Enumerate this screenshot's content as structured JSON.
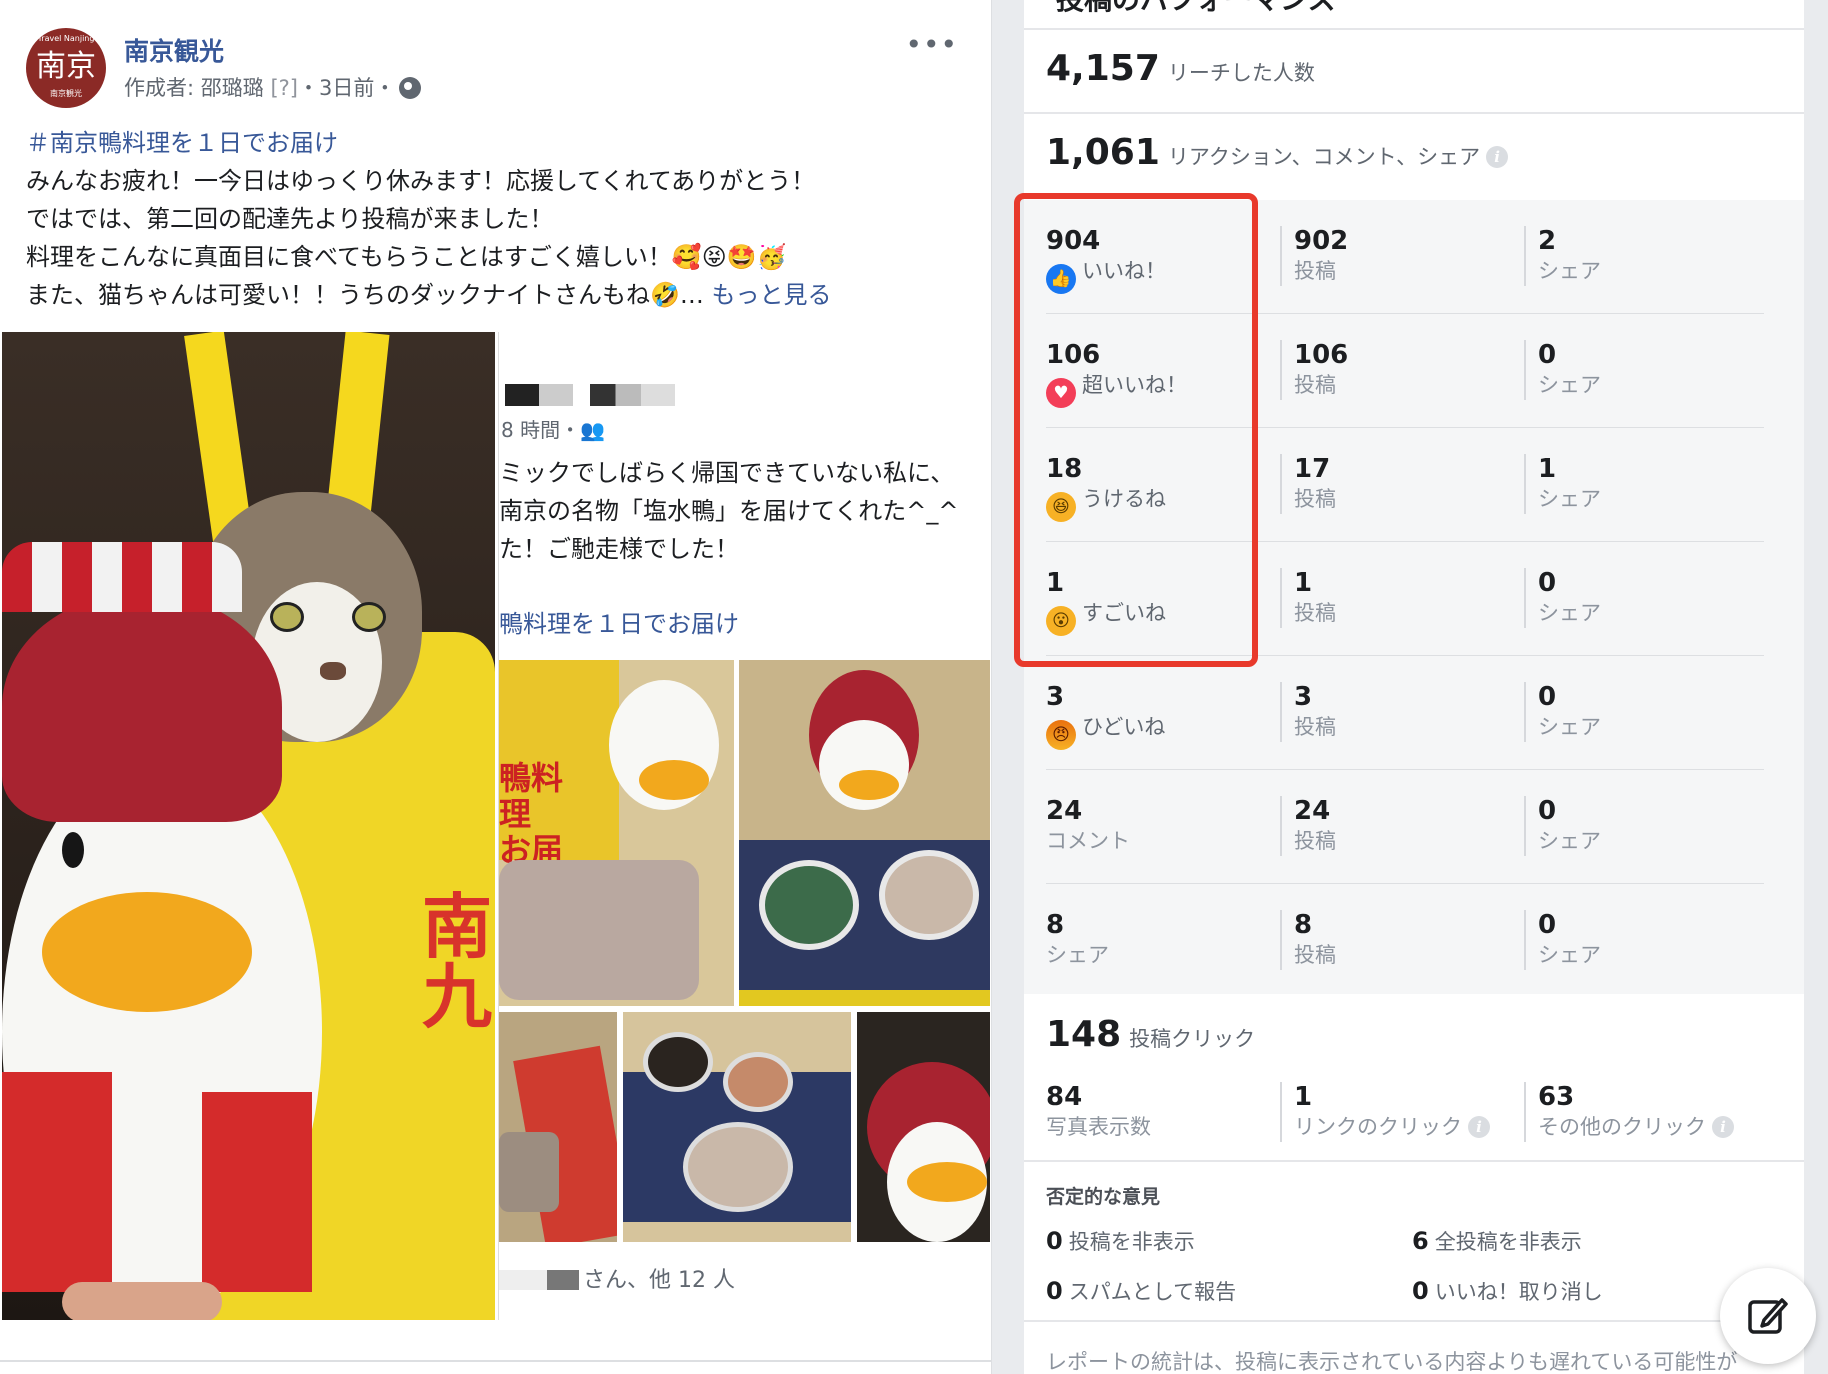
{
  "post": {
    "avatar": {
      "top": "Travel Nanjing",
      "main": "南京",
      "sub": "南京観光"
    },
    "page_name": "南京観光",
    "meta_author": "作成者: 邵璐璐",
    "meta_q": "[?]",
    "meta_time": "・3日前・",
    "more_icon": "•••",
    "hashtag": "＃南京鴨料理を１日でお届け",
    "lines": [
      "みんなお疲れ！一今日はゆっくり休みます！応援してくれてありがとう！",
      "ではでは、第二回の配達先より投稿が来ました！",
      "料理をこんなに真面目に食べてもらうことはすごく嬉しい！🥰😝🤩🥳",
      "また、猫ちゃんは可愛い！！うちのダックナイトさんもね🤣…"
    ],
    "see_more": "もっと見る",
    "shared": {
      "time": "8 時間・👥",
      "text_lines": [
        "ミックでしばらく帰国できていない私に、",
        "南京の名物「塩水鴨」を届けてくれた^_^",
        "た！ご馳走様でした！"
      ],
      "hashtag": "鴨料理を１日でお届け",
      "likes": "さん、他 12 人"
    }
  },
  "insights": {
    "title": "投稿のパフォーマンス",
    "reach": {
      "value": "4,157",
      "label": "リーチした人数"
    },
    "engagement": {
      "value": "1,061",
      "label": "リアクション、コメント、シェア"
    },
    "rows": [
      {
        "value": "904",
        "label": "いいね！",
        "icon": "like-icon",
        "posts": "902",
        "posts_label": "投稿",
        "shares": "2",
        "shares_label": "シェア"
      },
      {
        "value": "106",
        "label": "超いいね！",
        "icon": "love-icon",
        "posts": "106",
        "posts_label": "投稿",
        "shares": "0",
        "shares_label": "シェア"
      },
      {
        "value": "18",
        "label": "うけるね",
        "icon": "haha-icon",
        "posts": "17",
        "posts_label": "投稿",
        "shares": "1",
        "shares_label": "シェア"
      },
      {
        "value": "1",
        "label": "すごいね",
        "icon": "wow-icon",
        "posts": "1",
        "posts_label": "投稿",
        "shares": "0",
        "shares_label": "シェア"
      },
      {
        "value": "3",
        "label": "ひどいね",
        "icon": "angry-icon",
        "posts": "3",
        "posts_label": "投稿",
        "shares": "0",
        "shares_label": "シェア"
      },
      {
        "value": "24",
        "label": "コメント",
        "icon": "",
        "posts": "24",
        "posts_label": "投稿",
        "shares": "0",
        "shares_label": "シェア"
      },
      {
        "value": "8",
        "label": "シェア",
        "icon": "",
        "posts": "8",
        "posts_label": "投稿",
        "shares": "0",
        "shares_label": "シェア"
      }
    ],
    "clicks": {
      "value": "148",
      "label": "投稿クリック",
      "photo": {
        "value": "84",
        "label": "写真表示数"
      },
      "link": {
        "value": "1",
        "label": "リンクのクリック"
      },
      "other": {
        "value": "63",
        "label": "その他のクリック"
      }
    },
    "negative": {
      "title": "否定的な意見",
      "hide_post": {
        "value": "0",
        "label": "投稿を非表示"
      },
      "hide_all": {
        "value": "6",
        "label": "全投稿を非表示"
      },
      "spam": {
        "value": "0",
        "label": "スパムとして報告"
      },
      "unlike": {
        "value": "0",
        "label": "いいね！取り消し"
      }
    },
    "report_note": "レポートの統計は、投稿に表示されている内容よりも遅れている可能性が",
    "info_glyph": "i"
  },
  "colors": {
    "highlight": "#e8392b",
    "link": "#385898",
    "like": "#1877f2",
    "love": "#f33e58"
  }
}
